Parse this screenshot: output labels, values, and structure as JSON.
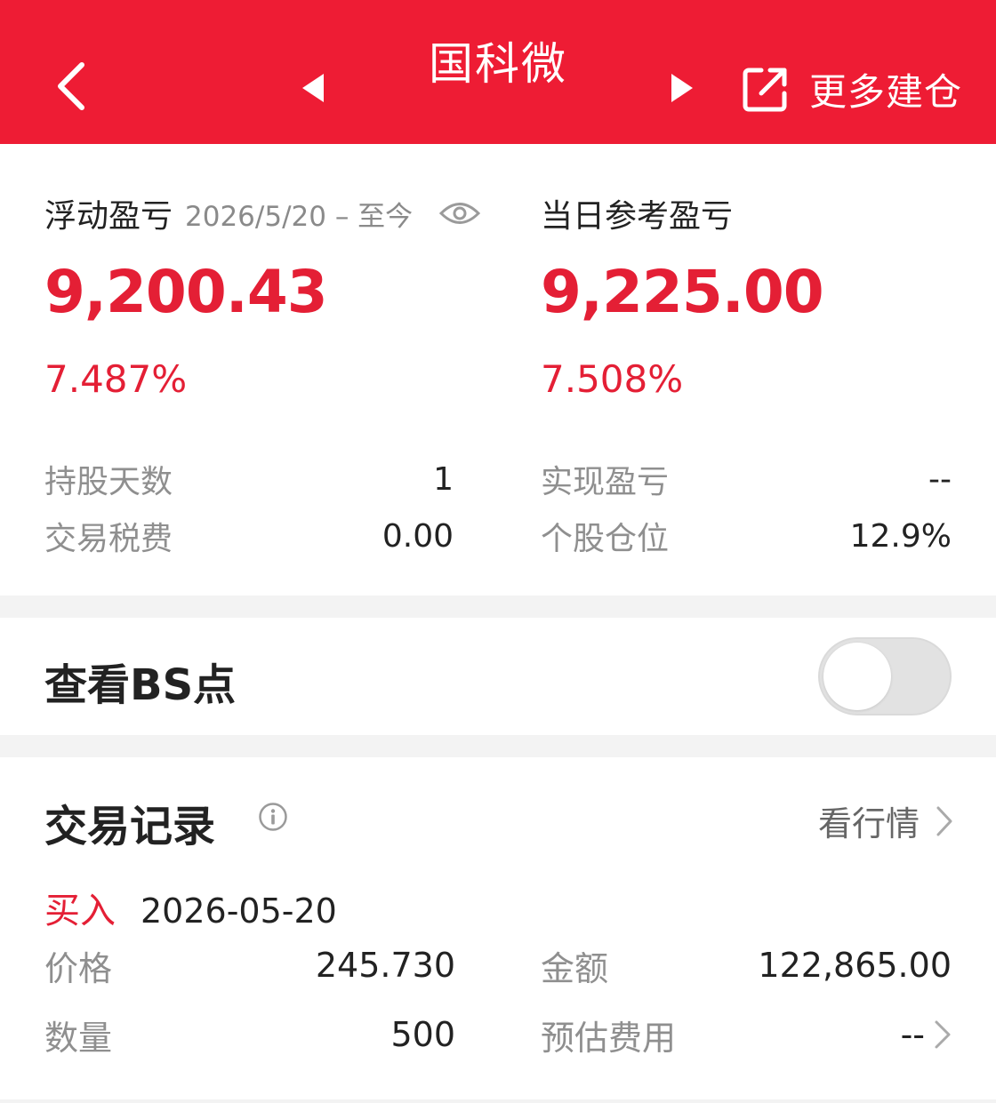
{
  "header": {
    "title": "国科微",
    "more_label": "更多建仓"
  },
  "profit": {
    "floating": {
      "label": "浮动盈亏",
      "date_range": "2026/5/20 – 至今",
      "value": "9,200.43",
      "percent": "7.487%"
    },
    "daily": {
      "label": "当日参考盈亏",
      "value": "9,225.00",
      "percent": "7.508%"
    },
    "stats": {
      "hold_days_label": "持股天数",
      "hold_days_value": "1",
      "tax_label": "交易税费",
      "tax_value": "0.00",
      "realized_label": "实现盈亏",
      "realized_value": "--",
      "position_label": "个股仓位",
      "position_value": "12.9%"
    }
  },
  "bs_points": {
    "label": "查看BS点",
    "enabled": false
  },
  "records": {
    "title": "交易记录",
    "market_link": "看行情",
    "trade": {
      "type": "买入",
      "date": "2026-05-20",
      "price_label": "价格",
      "price_value": "245.730",
      "amount_label": "金额",
      "amount_value": "122,865.00",
      "qty_label": "数量",
      "qty_value": "500",
      "fee_label": "预估费用",
      "fee_value": "--"
    }
  },
  "colors": {
    "brand_red": "#ee1c34",
    "profit_red": "#e41f35",
    "muted_gray": "#8f8f8f"
  },
  "icons": [
    "back-arrow-icon",
    "prev-triangle-icon",
    "next-triangle-icon",
    "share-icon",
    "eye-icon",
    "info-icon",
    "chevron-right-icon"
  ]
}
